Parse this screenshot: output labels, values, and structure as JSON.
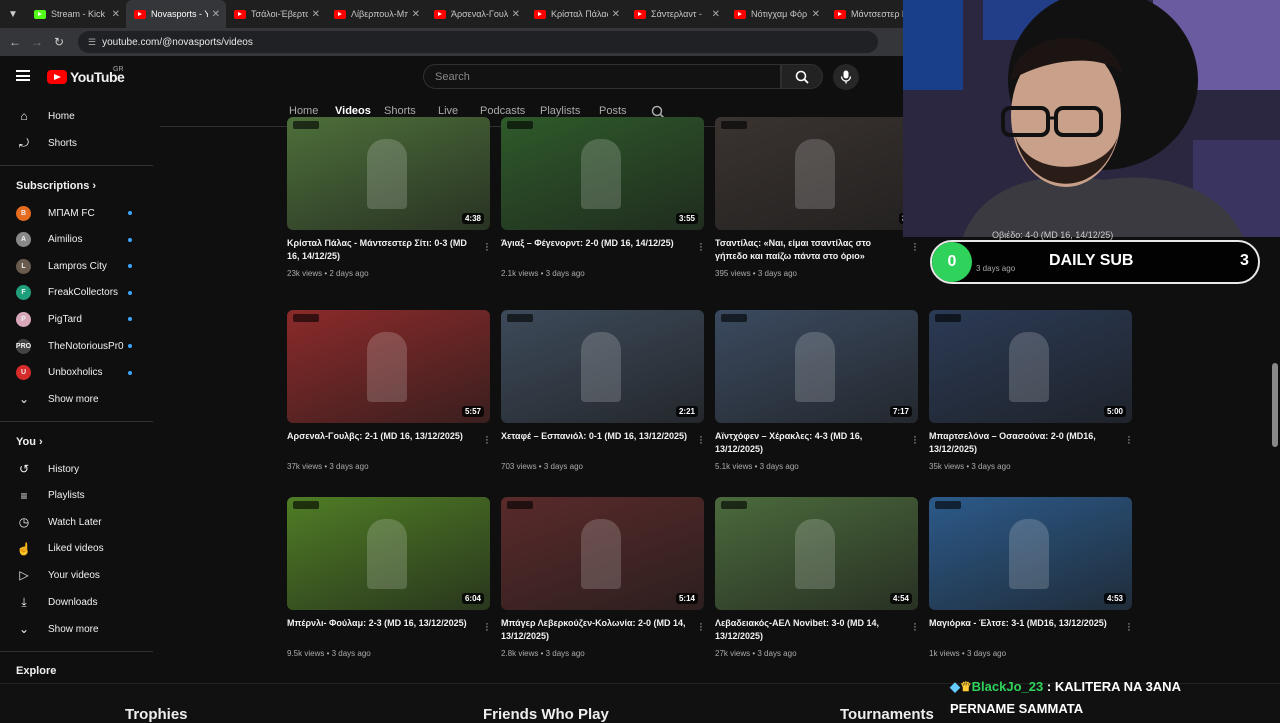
{
  "tabs": [
    {
      "title": "Stream - Kick D",
      "fav": "#53fc18",
      "active": false
    },
    {
      "title": "Novasports - Y",
      "fav": "#ff0000",
      "active": true
    },
    {
      "title": "Τσάλοι-Έβερτο",
      "fav": "#ff0000",
      "active": false
    },
    {
      "title": "Λίβερπουλ-Μπ",
      "fav": "#ff0000",
      "active": false
    },
    {
      "title": "Άρσεναλ-Γουλ",
      "fav": "#ff0000",
      "active": false
    },
    {
      "title": "Κρίσταλ Πάλας",
      "fav": "#ff0000",
      "active": false
    },
    {
      "title": "Σάντερλαντ -",
      "fav": "#ff0000",
      "active": false
    },
    {
      "title": "Νότιγχαμ Φόρ",
      "fav": "#ff0000",
      "active": false
    },
    {
      "title": "Μάντσεστερ Γ",
      "fav": "#ff0000",
      "active": false
    }
  ],
  "address": {
    "url": "youtube.com/@novasports/videos"
  },
  "header": {
    "logo": "YouTube",
    "country": "GR",
    "search_placeholder": "Search"
  },
  "sidebar": {
    "main": [
      {
        "label": "Home",
        "icon": "home-icon"
      },
      {
        "label": "Shorts",
        "icon": "shorts-icon"
      }
    ],
    "subscriptions_heading": "Subscriptions",
    "subscriptions": [
      {
        "label": "ΜΠΑΜ FC",
        "color": "#e56b1f",
        "initial": "B"
      },
      {
        "label": "Aimilios",
        "color": "#888888",
        "initial": "A"
      },
      {
        "label": "Lampros City",
        "color": "#6a5b4f",
        "initial": "L"
      },
      {
        "label": "FreakCollectors",
        "color": "#1e9e7a",
        "initial": "F"
      },
      {
        "label": "PigTard",
        "color": "#d8a7b9",
        "initial": "P"
      },
      {
        "label": "TheNotoriousPr0",
        "color": "#444444",
        "initial": "PRO"
      },
      {
        "label": "Unboxholics",
        "color": "#d62b2b",
        "initial": "U"
      }
    ],
    "show_more": "Show more",
    "you_heading": "You",
    "you": [
      {
        "label": "History",
        "icon": "history-icon"
      },
      {
        "label": "Playlists",
        "icon": "playlists-icon"
      },
      {
        "label": "Watch Later",
        "icon": "clock-icon"
      },
      {
        "label": "Liked videos",
        "icon": "thumbs-up-icon"
      },
      {
        "label": "Your videos",
        "icon": "video-icon"
      },
      {
        "label": "Downloads",
        "icon": "download-icon"
      }
    ],
    "show_more_2": "Show more",
    "explore_heading": "Explore"
  },
  "channel_tabs": [
    "Home",
    "Videos",
    "Shorts",
    "Live",
    "Podcasts",
    "Playlists",
    "Posts"
  ],
  "selected_tab": "Videos",
  "videos": [
    {
      "title": "Κρίσταλ Πάλας - Μάντσεστερ Σίτι: 0-3 (MD 16, 14/12/25)",
      "views": "23k views",
      "age": "2 days ago",
      "duration": "4:38",
      "bg": "#4d6f3a"
    },
    {
      "title": "Άγιαξ – Φέγενορντ: 2-0 (MD 16, 14/12/25)",
      "views": "2.1k views",
      "age": "3 days ago",
      "duration": "3:55",
      "bg": "#2e5a2a"
    },
    {
      "title": "Τσαντίλας: «Ναι, είμαι τσαντίλας στο γήπεδο και παίζω πάντα στο όριο»",
      "views": "395 views",
      "age": "3 days ago",
      "duration": "3:",
      "bg": "#3a3330"
    },
    {
      "title": "Αρσεναλ-Γουλβς: 2-1 (MD 16, 13/12/2025)",
      "views": "37k views",
      "age": "3 days ago",
      "duration": "5:57",
      "bg": "#8b2a2a"
    },
    {
      "title": "Χεταφέ – Εσπανιόλ: 0-1 (MD 16, 13/12/2025)",
      "views": "703 views",
      "age": "3 days ago",
      "duration": "2:21",
      "bg": "#3d4a5a"
    },
    {
      "title": "Αϊντχόφεν – Χέρακλες: 4-3 (MD 16, 13/12/2025)",
      "views": "5.1k views",
      "age": "3 days ago",
      "duration": "7:17",
      "bg": "#3b4a60"
    },
    {
      "title": "Μπαρτσελόνα – Οσασούνα: 2-0 (MD16, 13/12/2025)",
      "views": "35k views",
      "age": "3 days ago",
      "duration": "5:00",
      "bg": "#2b3a55"
    },
    {
      "title": "Μπέρνλι- Φούλαμ: 2-3 (MD 16, 13/12/2025)",
      "views": "9.5k views",
      "age": "3 days ago",
      "duration": "6:04",
      "bg": "#4f7d25"
    },
    {
      "title": "Μπάγερ Λεβερκούζεν-Κολωνία: 2-0 (MD 14, 13/12/2025)",
      "views": "2.8k views",
      "age": "3 days ago",
      "duration": "5:14",
      "bg": "#5a2a2a"
    },
    {
      "title": "Λεβαδειακός-ΑΕΛ Novibet: 3-0 (MD 14, 13/12/2025)",
      "views": "27k views",
      "age": "3 days ago",
      "duration": "4:54",
      "bg": "#4b6a3c"
    },
    {
      "title": "Μαγιόρκα - Έλτσε: 3-1 (MD16, 13/12/2025)",
      "views": "1k views",
      "age": "3 days ago",
      "duration": "4:53",
      "bg": "#2c5a8a"
    }
  ],
  "overlay": {
    "sub_count": "0",
    "sub_label": "DAILY SUB",
    "sub_goal": "3",
    "hidden_title": "Οβιέδο: 4-0 (MD 16, 14/12/25)",
    "hidden_age": "3 days ago",
    "chat_user": "BlackJo_23",
    "chat_sep": ":",
    "chat_msg1": "KALITERA NA 3ANA",
    "chat_msg2": "PERNAME SAMMATA"
  },
  "game_hud": [
    "Trophies",
    "Friends Who Play",
    "Tournaments"
  ],
  "colors": {
    "accent": "#ff0000",
    "link": "#3ea6ff",
    "sub_green": "#2fd35b"
  }
}
